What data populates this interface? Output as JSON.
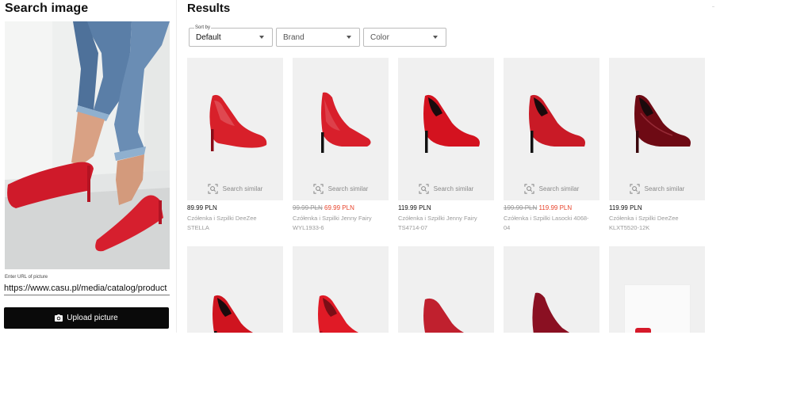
{
  "search_panel": {
    "title": "Search image",
    "url_label": "Enter URL of picture",
    "url_value": "https://www.casu.pl/media/catalog/product",
    "upload_label": "Upload picture",
    "upload_icon": "camera-icon"
  },
  "results": {
    "title": "Results",
    "filters": {
      "sort": {
        "legend": "Sort by",
        "value": "Default"
      },
      "brand": {
        "placeholder": "Brand"
      },
      "color": {
        "placeholder": "Color"
      }
    },
    "search_similar_label": "Search similar",
    "products": [
      {
        "price": "89.99 PLN",
        "name": "Czółenka i Szpilki DeeZee",
        "code": "STELLA",
        "color": "#d8202a"
      },
      {
        "old_price": "99.99 PLN",
        "sale_price": "69.99 PLN",
        "name": "Czółenka i Szpilki Jenny Fairy",
        "code": "WYL1933-6",
        "color": "#d81f2b"
      },
      {
        "price": "119.99 PLN",
        "name": "Czółenka i Szpilki Jenny Fairy",
        "code": "TS4714-07",
        "color": "#d4121f"
      },
      {
        "old_price": "199.99 PLN",
        "sale_price": "119.99 PLN",
        "name": "Czółenka i Szpilki Lasocki 4068-",
        "code": "04",
        "color": "#c91a26"
      },
      {
        "price": "119.99 PLN",
        "name": "Czółenka i Szpilki DeeZee",
        "code": "KLXT5520-12K",
        "color": "#6e0a14"
      },
      {
        "color": "#cf141f"
      },
      {
        "color": "#e01a26"
      },
      {
        "color": "#c0202e"
      },
      {
        "color": "#8a1022"
      },
      {
        "color": "#d61a2a"
      }
    ]
  }
}
